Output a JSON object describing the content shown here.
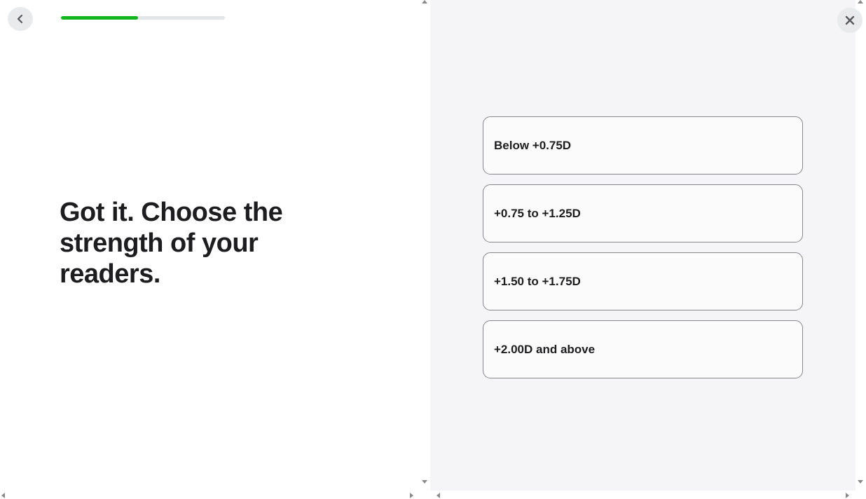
{
  "header": {
    "back_icon": "chevron-left-icon",
    "close_icon": "close-icon",
    "progress_fraction": 0.47,
    "progress_color": "#13b51d",
    "track_color": "#e4e5e7"
  },
  "main": {
    "headline": "Got it. Choose the strength of your readers."
  },
  "options": [
    {
      "label": "Below +0.75D"
    },
    {
      "label": "+0.75 to +1.25D"
    },
    {
      "label": "+1.50 to +1.75D"
    },
    {
      "label": "+2.00D and above"
    }
  ],
  "colors": {
    "left_background": "#ffffff",
    "right_background": "#f5f5f7",
    "option_border": "#86868b",
    "text": "#1d1d1f"
  }
}
